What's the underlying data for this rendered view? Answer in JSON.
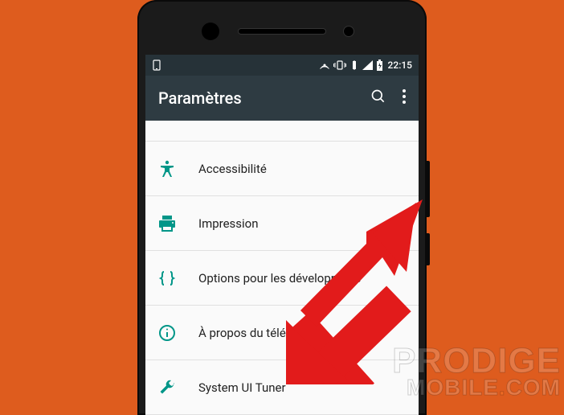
{
  "status": {
    "time": "22:15"
  },
  "appbar": {
    "title": "Paramètres"
  },
  "settings": {
    "items": [
      {
        "icon": "accessibility",
        "label": "Accessibilité"
      },
      {
        "icon": "print",
        "label": "Impression"
      },
      {
        "icon": "braces",
        "label": "Options pour les développeurs"
      },
      {
        "icon": "info",
        "label": "À propos du téléphone"
      },
      {
        "icon": "wrench",
        "label": "System UI Tuner"
      }
    ]
  },
  "watermark": {
    "line1": "PRODIGE",
    "line2_a": "MOBILE",
    "line2_b": "COM"
  }
}
